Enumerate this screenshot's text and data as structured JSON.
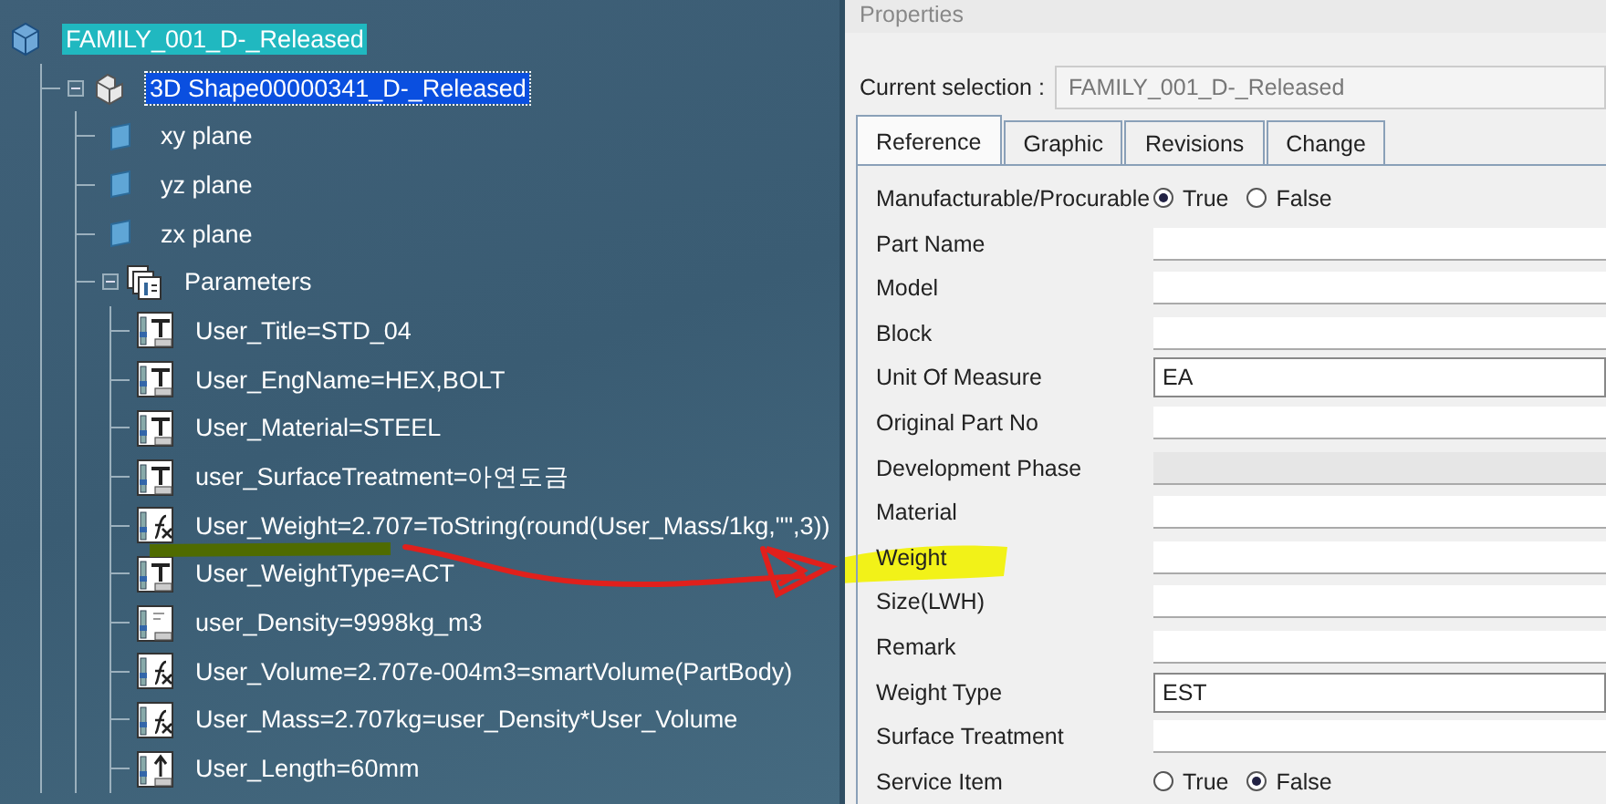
{
  "tree": {
    "nodes": [
      {
        "kind": "product",
        "label": "FAMILY_001_D-_Released",
        "highlighted": true,
        "selected": false,
        "children": [
          {
            "kind": "part",
            "label": "3D Shape00000341_D-_Released",
            "highlighted": false,
            "selected": true,
            "expanded": true,
            "children": [
              {
                "kind": "plane",
                "label": "xy plane",
                "highlighted": false,
                "selected": false
              },
              {
                "kind": "plane",
                "label": "yz plane",
                "highlighted": false,
                "selected": false
              },
              {
                "kind": "plane",
                "label": "zx plane",
                "highlighted": false,
                "selected": false
              },
              {
                "kind": "parameters",
                "label": "Parameters",
                "highlighted": false,
                "selected": false,
                "expanded": true,
                "children": [
                  {
                    "kind": "text",
                    "label": "User_Title=STD_04",
                    "highlighted": false,
                    "selected": false
                  },
                  {
                    "kind": "text",
                    "label": "User_EngName=HEX,BOLT",
                    "highlighted": false,
                    "selected": false
                  },
                  {
                    "kind": "text",
                    "label": "User_Material=STEEL",
                    "highlighted": false,
                    "selected": false
                  },
                  {
                    "kind": "text",
                    "label": "user_SurfaceTreatment=아연도금",
                    "highlighted": false,
                    "selected": false
                  },
                  {
                    "kind": "formula",
                    "label": "User_Weight=2.707=ToString(round(User_Mass/1kg,\"\",3))",
                    "highlighted": false,
                    "selected": false
                  },
                  {
                    "kind": "text",
                    "label": "User_WeightType=ACT",
                    "highlighted": false,
                    "selected": false
                  },
                  {
                    "kind": "real",
                    "label": "user_Density=9998kg_m3",
                    "highlighted": false,
                    "selected": false
                  },
                  {
                    "kind": "formula",
                    "label": "User_Volume=2.707e-004m3=smartVolume(PartBody)",
                    "highlighted": false,
                    "selected": false
                  },
                  {
                    "kind": "formula",
                    "label": "User_Mass=2.707kg=user_Density*User_Volume",
                    "highlighted": false,
                    "selected": false
                  },
                  {
                    "kind": "length",
                    "label": "User_Length=60mm",
                    "highlighted": false,
                    "selected": false
                  }
                ]
              }
            ]
          }
        ]
      }
    ]
  },
  "properties": {
    "title": "Properties",
    "current_selection": {
      "label": "Current selection :",
      "value": "FAMILY_001_D-_Released",
      "disabled": true
    },
    "tabs": [
      {
        "label": "Reference",
        "selected": true
      },
      {
        "label": "Graphic",
        "selected": false
      },
      {
        "label": "Revisions",
        "selected": false
      },
      {
        "label": "Change",
        "selected": false
      }
    ],
    "rows": [
      {
        "kind": "radio",
        "label": "Manufacturable/Procurable",
        "options": [
          {
            "label": "True",
            "selected": true
          },
          {
            "label": "False",
            "selected": false
          }
        ]
      },
      {
        "kind": "line",
        "label": "Part Name",
        "disabled": false
      },
      {
        "kind": "line",
        "label": "Model",
        "disabled": false
      },
      {
        "kind": "line",
        "label": "Block",
        "disabled": false
      },
      {
        "kind": "box",
        "label": "Unit Of Measure",
        "value": "EA",
        "disabled": false
      },
      {
        "kind": "line",
        "label": "Original Part No",
        "disabled": false
      },
      {
        "kind": "line",
        "label": "Development Phase",
        "disabled": true
      },
      {
        "kind": "line",
        "label": "Material",
        "disabled": false
      },
      {
        "kind": "line",
        "label": "Weight",
        "disabled": false
      },
      {
        "kind": "line",
        "label": "Size(LWH)",
        "disabled": false
      },
      {
        "kind": "line",
        "label": "Remark",
        "disabled": false
      },
      {
        "kind": "box",
        "label": "Weight Type",
        "value": "EST",
        "disabled": false
      },
      {
        "kind": "line",
        "label": "Surface Treatment",
        "disabled": false
      },
      {
        "kind": "radio",
        "label": "Service Item",
        "options": [
          {
            "label": "True",
            "selected": false
          },
          {
            "label": "False",
            "selected": true
          }
        ]
      }
    ]
  },
  "annotations": [
    {
      "kind": "underline",
      "color": "#4f6b00"
    },
    {
      "kind": "arrow",
      "color": "#e0201c"
    },
    {
      "kind": "highlight",
      "color": "#f2f218"
    }
  ]
}
